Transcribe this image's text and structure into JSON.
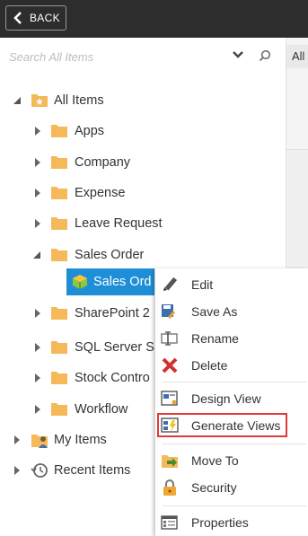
{
  "header": {
    "back_label": "BACK"
  },
  "search": {
    "placeholder": "Search All Items"
  },
  "right_pane": {
    "tab_label": "All"
  },
  "tree": {
    "root_label": "All Items",
    "children": [
      "Apps",
      "Company",
      "Expense",
      "Leave Request",
      "Sales Order"
    ],
    "selected_label": "Sales Ord",
    "after": [
      "SharePoint 2",
      "SQL Server Se",
      "Stock Contro",
      "Workflow"
    ],
    "my_items": "My Items",
    "recent_items": "Recent Items"
  },
  "context_menu": {
    "items": [
      "Edit",
      "Save As",
      "Rename",
      "Delete",
      "Design View",
      "Generate Views",
      "Move To",
      "Security",
      "Properties"
    ],
    "highlighted": "Generate Views"
  },
  "colors": {
    "selection": "#1e8fd6",
    "highlight_border": "#e03a3a",
    "folder": "#f5b95a",
    "topbar": "#2d2d2d"
  }
}
